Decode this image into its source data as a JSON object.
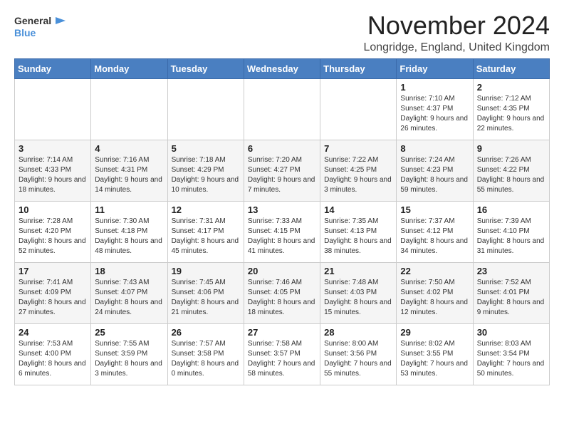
{
  "header": {
    "logo_general": "General",
    "logo_blue": "Blue",
    "month_title": "November 2024",
    "location": "Longridge, England, United Kingdom"
  },
  "weekdays": [
    "Sunday",
    "Monday",
    "Tuesday",
    "Wednesday",
    "Thursday",
    "Friday",
    "Saturday"
  ],
  "weeks": [
    [
      {
        "day": "",
        "info": ""
      },
      {
        "day": "",
        "info": ""
      },
      {
        "day": "",
        "info": ""
      },
      {
        "day": "",
        "info": ""
      },
      {
        "day": "",
        "info": ""
      },
      {
        "day": "1",
        "info": "Sunrise: 7:10 AM\nSunset: 4:37 PM\nDaylight: 9 hours and 26 minutes."
      },
      {
        "day": "2",
        "info": "Sunrise: 7:12 AM\nSunset: 4:35 PM\nDaylight: 9 hours and 22 minutes."
      }
    ],
    [
      {
        "day": "3",
        "info": "Sunrise: 7:14 AM\nSunset: 4:33 PM\nDaylight: 9 hours and 18 minutes."
      },
      {
        "day": "4",
        "info": "Sunrise: 7:16 AM\nSunset: 4:31 PM\nDaylight: 9 hours and 14 minutes."
      },
      {
        "day": "5",
        "info": "Sunrise: 7:18 AM\nSunset: 4:29 PM\nDaylight: 9 hours and 10 minutes."
      },
      {
        "day": "6",
        "info": "Sunrise: 7:20 AM\nSunset: 4:27 PM\nDaylight: 9 hours and 7 minutes."
      },
      {
        "day": "7",
        "info": "Sunrise: 7:22 AM\nSunset: 4:25 PM\nDaylight: 9 hours and 3 minutes."
      },
      {
        "day": "8",
        "info": "Sunrise: 7:24 AM\nSunset: 4:23 PM\nDaylight: 8 hours and 59 minutes."
      },
      {
        "day": "9",
        "info": "Sunrise: 7:26 AM\nSunset: 4:22 PM\nDaylight: 8 hours and 55 minutes."
      }
    ],
    [
      {
        "day": "10",
        "info": "Sunrise: 7:28 AM\nSunset: 4:20 PM\nDaylight: 8 hours and 52 minutes."
      },
      {
        "day": "11",
        "info": "Sunrise: 7:30 AM\nSunset: 4:18 PM\nDaylight: 8 hours and 48 minutes."
      },
      {
        "day": "12",
        "info": "Sunrise: 7:31 AM\nSunset: 4:17 PM\nDaylight: 8 hours and 45 minutes."
      },
      {
        "day": "13",
        "info": "Sunrise: 7:33 AM\nSunset: 4:15 PM\nDaylight: 8 hours and 41 minutes."
      },
      {
        "day": "14",
        "info": "Sunrise: 7:35 AM\nSunset: 4:13 PM\nDaylight: 8 hours and 38 minutes."
      },
      {
        "day": "15",
        "info": "Sunrise: 7:37 AM\nSunset: 4:12 PM\nDaylight: 8 hours and 34 minutes."
      },
      {
        "day": "16",
        "info": "Sunrise: 7:39 AM\nSunset: 4:10 PM\nDaylight: 8 hours and 31 minutes."
      }
    ],
    [
      {
        "day": "17",
        "info": "Sunrise: 7:41 AM\nSunset: 4:09 PM\nDaylight: 8 hours and 27 minutes."
      },
      {
        "day": "18",
        "info": "Sunrise: 7:43 AM\nSunset: 4:07 PM\nDaylight: 8 hours and 24 minutes."
      },
      {
        "day": "19",
        "info": "Sunrise: 7:45 AM\nSunset: 4:06 PM\nDaylight: 8 hours and 21 minutes."
      },
      {
        "day": "20",
        "info": "Sunrise: 7:46 AM\nSunset: 4:05 PM\nDaylight: 8 hours and 18 minutes."
      },
      {
        "day": "21",
        "info": "Sunrise: 7:48 AM\nSunset: 4:03 PM\nDaylight: 8 hours and 15 minutes."
      },
      {
        "day": "22",
        "info": "Sunrise: 7:50 AM\nSunset: 4:02 PM\nDaylight: 8 hours and 12 minutes."
      },
      {
        "day": "23",
        "info": "Sunrise: 7:52 AM\nSunset: 4:01 PM\nDaylight: 8 hours and 9 minutes."
      }
    ],
    [
      {
        "day": "24",
        "info": "Sunrise: 7:53 AM\nSunset: 4:00 PM\nDaylight: 8 hours and 6 minutes."
      },
      {
        "day": "25",
        "info": "Sunrise: 7:55 AM\nSunset: 3:59 PM\nDaylight: 8 hours and 3 minutes."
      },
      {
        "day": "26",
        "info": "Sunrise: 7:57 AM\nSunset: 3:58 PM\nDaylight: 8 hours and 0 minutes."
      },
      {
        "day": "27",
        "info": "Sunrise: 7:58 AM\nSunset: 3:57 PM\nDaylight: 7 hours and 58 minutes."
      },
      {
        "day": "28",
        "info": "Sunrise: 8:00 AM\nSunset: 3:56 PM\nDaylight: 7 hours and 55 minutes."
      },
      {
        "day": "29",
        "info": "Sunrise: 8:02 AM\nSunset: 3:55 PM\nDaylight: 7 hours and 53 minutes."
      },
      {
        "day": "30",
        "info": "Sunrise: 8:03 AM\nSunset: 3:54 PM\nDaylight: 7 hours and 50 minutes."
      }
    ]
  ]
}
